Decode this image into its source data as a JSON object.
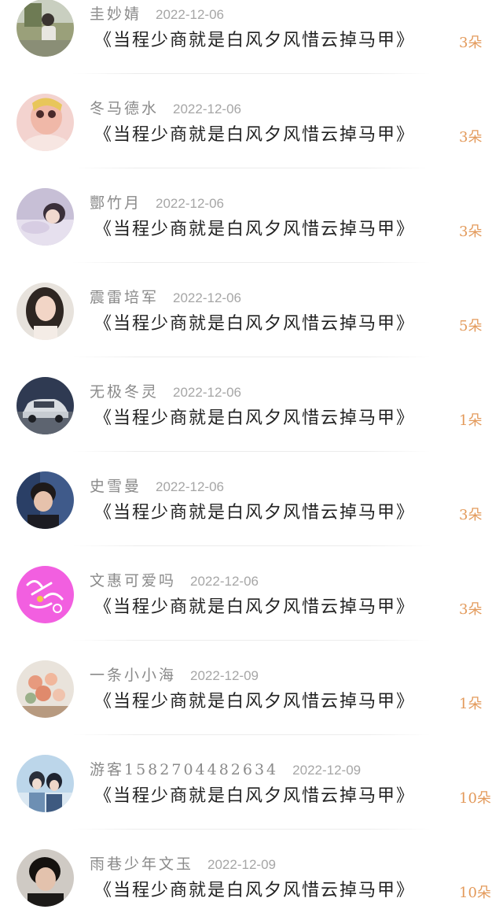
{
  "entries": [
    {
      "name": "圭妙婧",
      "date": "2022-12-06",
      "title": "《当程少商就是白风夕风惜云掉马甲》",
      "count": "3朵",
      "avatar": "outdoor-person-avatar"
    },
    {
      "name": "冬马德水",
      "date": "2022-12-06",
      "title": "《当程少商就是白风夕风惜云掉马甲》",
      "count": "3朵",
      "avatar": "pink-portrait-avatar"
    },
    {
      "name": "酆竹月",
      "date": "2022-12-06",
      "title": "《当程少商就是白风夕风惜云掉马甲》",
      "count": "3朵",
      "avatar": "girl-lying-avatar"
    },
    {
      "name": "震雷培军",
      "date": "2022-12-06",
      "title": "《当程少商就是白风夕风惜云掉马甲》",
      "count": "5朵",
      "avatar": "woman-portrait-avatar"
    },
    {
      "name": "无极冬灵",
      "date": "2022-12-06",
      "title": "《当程少商就是白风夕风惜云掉马甲》",
      "count": "1朵",
      "avatar": "car-avatar"
    },
    {
      "name": "史雪曼",
      "date": "2022-12-06",
      "title": "《当程少商就是白风夕风惜云掉马甲》",
      "count": "3朵",
      "avatar": "man-portrait-avatar"
    },
    {
      "name": "文惠可爱吗",
      "date": "2022-12-06",
      "title": "《当程少商就是白风夕风惜云掉马甲》",
      "count": "3朵",
      "avatar": "pink-lettering-avatar"
    },
    {
      "name": "一条小小海",
      "date": "2022-12-09",
      "title": "《当程少商就是白风夕风惜云掉马甲》",
      "count": "1朵",
      "avatar": "flowers-avatar"
    },
    {
      "name": "游客1582704482634",
      "date": "2022-12-09",
      "title": "《当程少商就是白风夕风惜云掉马甲》",
      "count": "10朵",
      "avatar": "couple-avatar"
    },
    {
      "name": "雨巷少年文玉",
      "date": "2022-12-09",
      "title": "《当程少商就是白风夕风惜云掉马甲》",
      "count": "10朵",
      "avatar": "young-man-avatar"
    }
  ]
}
